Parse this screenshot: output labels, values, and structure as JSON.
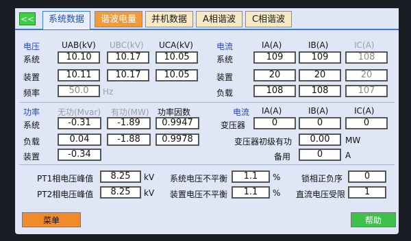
{
  "tabs": {
    "back": "<<",
    "items": [
      "系统数据",
      "谐波电量",
      "并机数据",
      "A相谐波",
      "C相谐波"
    ]
  },
  "voltage": {
    "section": "电压",
    "headers": [
      "UAB(kV)",
      "UBC(kV)",
      "UCA(kV)"
    ],
    "rows": [
      {
        "label": "系统",
        "values": [
          "10.10",
          "10.17",
          "10.05"
        ]
      },
      {
        "label": "装置",
        "values": [
          "10.11",
          "10.17",
          "10.05"
        ]
      }
    ],
    "freq_label": "频率",
    "freq_value": "50.0",
    "freq_unit": "Hz"
  },
  "current": {
    "section": "电流",
    "headers": [
      "IA(A)",
      "IB(A)",
      "IC(A)"
    ],
    "rows": [
      {
        "label": "系统",
        "values": [
          "109",
          "109",
          "108"
        ]
      },
      {
        "label": "装置",
        "values": [
          "20",
          "20",
          "20"
        ]
      },
      {
        "label": "负载",
        "values": [
          "108",
          "108",
          "107"
        ]
      }
    ]
  },
  "power": {
    "section": "功率",
    "headers": [
      "无功(Mvar)",
      "有功(MW)",
      "功率因数"
    ],
    "rows": [
      {
        "label": "系统",
        "values": [
          "-0.31",
          "-1.89",
          "0.9947"
        ]
      },
      {
        "label": "负载",
        "values": [
          "0.04",
          "-1.88",
          "0.9978"
        ]
      },
      {
        "label": "装置",
        "values": [
          "-0.34"
        ]
      }
    ]
  },
  "transformer": {
    "section": "电流",
    "headers": [
      "IA(A)",
      "IB(A)",
      "IC(A)"
    ],
    "row_label": "变压器",
    "values": [
      "0",
      "0",
      "0"
    ],
    "initial_power_label": "变压器初级有功",
    "initial_power_value": "0.00",
    "initial_power_unit": "MW",
    "spare_label": "备用",
    "spare_value": "0",
    "spare_unit": "A"
  },
  "bottom": {
    "pt1_label": "PT1相电压峰值",
    "pt1_value": "8.25",
    "pt1_unit": "kV",
    "pt2_label": "PT2相电压峰值",
    "pt2_value": "8.25",
    "pt2_unit": "kV",
    "sys_unbal_label": "系统电压不平衡",
    "sys_unbal_value": "1.1",
    "sys_unbal_unit": "%",
    "dev_unbal_label": "装置电压不平衡",
    "dev_unbal_value": "1.1",
    "dev_unbal_unit": "%",
    "lock_label": "锁相正负序",
    "lock_value": "0",
    "dc_label": "直流电压受限",
    "dc_value": "1"
  },
  "buttons": {
    "menu": "菜单",
    "help": "帮助"
  }
}
